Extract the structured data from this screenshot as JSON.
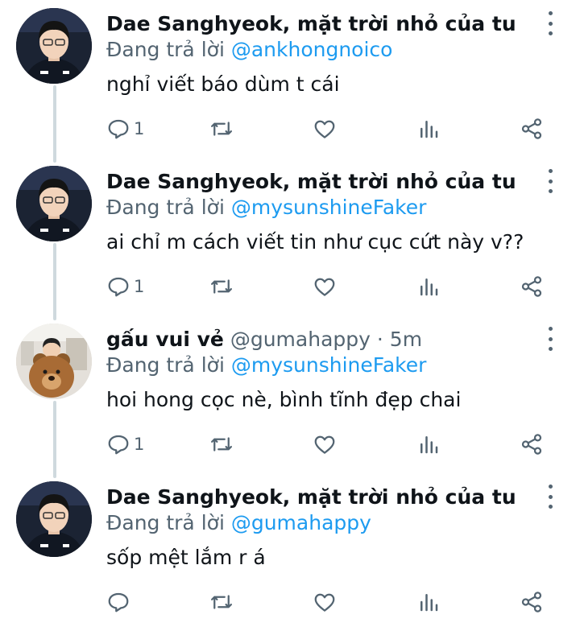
{
  "labels": {
    "replying_prefix": "Đang trả lời"
  },
  "colors": {
    "accent": "#1d9bf0",
    "secondary_text": "#536471",
    "thread_line": "#cfd9de"
  },
  "tweets": [
    {
      "author": "Dae Sanghyeok, mặt trời nhỏ của tui",
      "handle": "@...",
      "time": "",
      "reply_to": "@ankhongnoico",
      "text": "nghỉ viết báo dùm t cái",
      "reply_count": "1",
      "avatar": "faker-avatar"
    },
    {
      "author": "Dae Sanghyeok, mặt trời nhỏ của tui",
      "handle": "@...",
      "time": "",
      "reply_to": "@mysunshineFaker",
      "text": "ai chỉ m cách viết tin như cục cứt này v??",
      "reply_count": "1",
      "avatar": "faker-avatar"
    },
    {
      "author": "gấu vui vẻ",
      "handle": "@gumahappy",
      "time": "· 5m",
      "reply_to": "@mysunshineFaker",
      "text": "hoi hong cọc nè, bình tĩnh đẹp chai",
      "reply_count": "1",
      "avatar": "bear-avatar"
    },
    {
      "author": "Dae Sanghyeok, mặt trời nhỏ của tui",
      "handle": "@...",
      "time": "",
      "reply_to": "@gumahappy",
      "text": "sốp mệt lắm r á",
      "reply_count": "",
      "avatar": "faker-avatar"
    }
  ]
}
